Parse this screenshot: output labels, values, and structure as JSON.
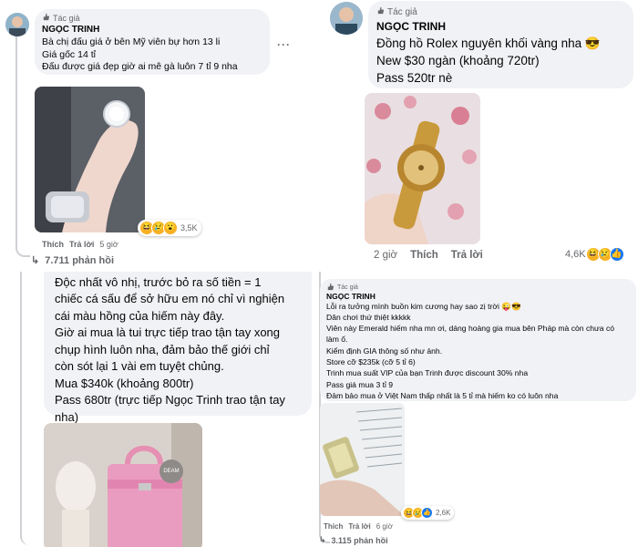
{
  "author_badge": "Tác giả",
  "author_name": "NGỌC TRINH",
  "actions": {
    "like": "Thích",
    "reply": "Trả lời"
  },
  "comments": [
    {
      "id": "c1",
      "lines": [
        "Bà chị đấu giá ở bên Mỹ viên bự hơn 13 li",
        "Giá gốc 14 tỉ",
        "Đấu được giá đẹp giờ ai mê gà luôn 7 tỉ 9 nha"
      ],
      "time": "5 giờ",
      "reaction_count": "3,5K",
      "replies": "7.711 phản hồi",
      "media": "ring-and-watch-photo"
    },
    {
      "id": "c2",
      "lines": [
        "Đồng hồ Rolex nguyên khối vàng nha 😎",
        "New $30 ngàn (khoảng 720tr)",
        "Pass 520tr nè"
      ],
      "time": "2 giờ",
      "reaction_count": "4,6K",
      "media": "gold-rolex-photo"
    },
    {
      "id": "c3",
      "lines": [
        "Độc nhất vô nhị, trước bỏ ra số tiền = 1",
        "chiếc cá sấu để sở hữu em nó chỉ vì nghiện",
        "cái màu hồng của hiếm này đây.",
        "Giờ ai mua là tui trực tiếp trao tận tay xong",
        "chụp hình luôn nha, đảm bảo thế giới chỉ",
        "còn sót lại 1 vài em tuyệt chủng.",
        "Mua $340k (khoảng 800tr)",
        "Pass 680tr (trực tiếp Ngọc Trinh trao tận tay",
        "nha)"
      ],
      "media": "pink-birkin-photo",
      "brand_tag": "DEAM"
    },
    {
      "id": "c4",
      "lines": [
        "Lỗi ra tưởng mình buồn kim cương hay sao zị trời 😜😎",
        "Dân chơi thứ thiệt kkkkk",
        "Viên này Emerald hiếm nha mn ơi, dáng hoàng gia mua bên Pháp mà còn chưa có",
        "làm ố.",
        "Kiểm định GIA thông số như ảnh.",
        "Store cỡ $235k (cỡ 5 tỉ 6)",
        "Trinh mua suất VIP của bạn Trinh được discount 30% nha",
        "Pass giá mua 3 tỉ 9",
        "Đảm bảo mua ở Việt Nam thấp nhất là 5 tỉ mà hiếm ko có luôn nha"
      ],
      "time": "6 giờ",
      "reaction_count": "2,6K",
      "replies": "3.115 phản hồi",
      "media": "emerald-diamond-certificate-photo"
    }
  ],
  "colors": {
    "bubble": "#f0f2f5",
    "secondary_text": "#65676b",
    "like_blue": "#1877f2"
  }
}
